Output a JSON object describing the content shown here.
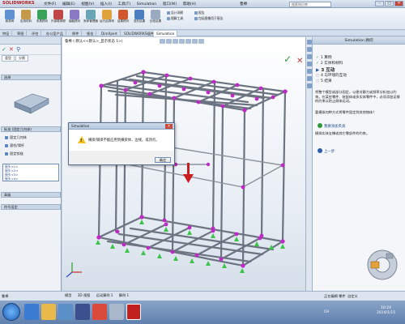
{
  "app": {
    "logo": "SOLIDWORKS",
    "menus": [
      "文件(F)",
      "编辑(E)",
      "视图(V)",
      "插入(I)",
      "工具(T)",
      "Simulation",
      "窗口(W)",
      "帮助(H)"
    ],
    "window_title": "鲁棒",
    "search_placeholder": "搜索知识库"
  },
  "ribbon": {
    "buttons": [
      "新算例",
      "应用材料",
      "夹具顾问",
      "外部载荷顾问",
      "接触顾问",
      "壳体管理器",
      "运行此算例",
      "结果顾问",
      "变形结果",
      "比较结果"
    ],
    "small_items": [
      "设计洞察",
      "图解工具",
      "报告",
      "包括图像用于报告"
    ]
  },
  "tabs": [
    "特征",
    "草图",
    "评估",
    "办公室产品",
    "焊件",
    "钣金",
    "DimXpert",
    "SOLIDWORKS插件",
    "Simulation"
  ],
  "left_panel": {
    "subtabs": [
      "类型",
      "分割"
    ],
    "groups": {
      "section1": "选择",
      "section2": "标准 (固定几何体)",
      "section3": "高级",
      "section4": "符号设定"
    },
    "fixture_options": [
      "固定几何体",
      "滚柱/滑杆",
      "固定铰链"
    ],
    "selection_list": [
      "接头<1>",
      "接头<2>",
      "接头<3>",
      "接头<4>"
    ]
  },
  "viewport": {
    "tree_item": "鲁棒 (-默认<<默认>_显示状态 1>)",
    "confirm_icon": "check-icon",
    "cancel_icon": "close-icon"
  },
  "dialog": {
    "title": "Simulation",
    "message": "横梁/钢梁不能应用到横梁体，边线，或顶点。",
    "ok_label": "确定",
    "close_label": "X"
  },
  "right_pane": {
    "header": "Simulation 顾问",
    "steps": [
      {
        "label": "1 算例",
        "state": "done"
      },
      {
        "label": "2 实体和材料",
        "state": "done"
      },
      {
        "label": "3 互动",
        "state": "current"
      },
      {
        "label": "4 与环境的互动",
        "state": "todo"
      },
      {
        "label": "5 结果",
        "state": "todo"
      }
    ],
    "description": "将整个模型或部分固定，以便对静力或频率分析加以约束。在某些零件、装配体或多实体零件中，必须添加足够的约束以防止刚体运动。",
    "question": "要模拟何种方式将零件固定到其他物体？",
    "option_text": "模拟实体支撑或其它零部件的约束。",
    "link_next": "我要添加夹具",
    "link_prev": "上一步"
  },
  "statusbar": {
    "left": "鲁棒",
    "tabs": [
      "模型",
      "3D 视图",
      "运动算例 1",
      "算例 1"
    ],
    "right": "正在编辑 零件",
    "units": "自定义"
  },
  "taskbar": {
    "time": "10:24",
    "date": "2014/1/15",
    "tray_text": "CH"
  }
}
